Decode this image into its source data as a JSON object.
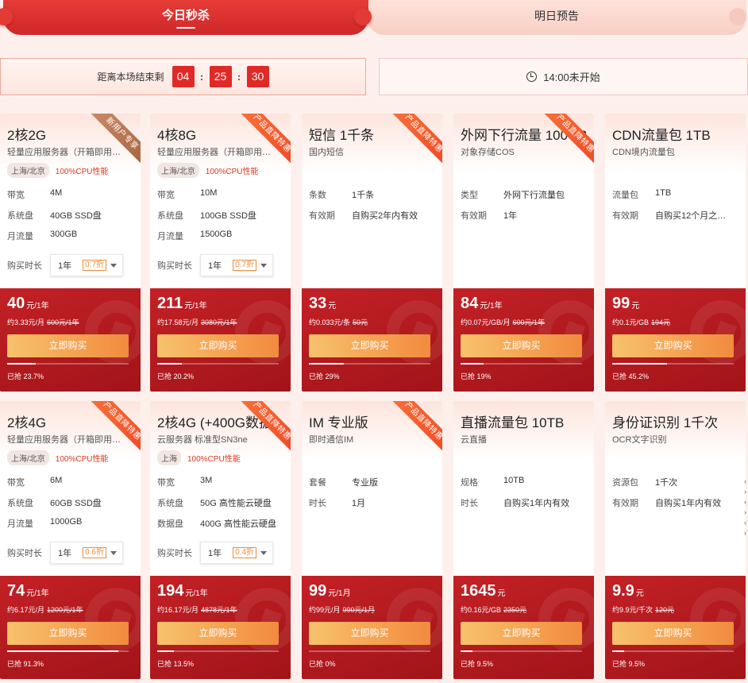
{
  "tabs": {
    "today": "今日秒杀",
    "tomorrow": "明日预告"
  },
  "countdown": {
    "label": "距离本场结束剩",
    "hours": "04",
    "minutes": "25",
    "seconds": "30"
  },
  "next_session": "14:00未开始",
  "labels": {
    "buy_duration": "购买时长",
    "buy_button": "立即购买"
  },
  "cards": [
    {
      "title": "2核2G",
      "subtitle": "轻量应用服务器（开箱即用…",
      "ribbon": "新用户专享",
      "ribbon_style": "grey",
      "location": "上海/北京",
      "cpu": "100%CPU性能",
      "specs": [
        {
          "k": "带宽",
          "v": "4M"
        },
        {
          "k": "系统盘",
          "v": "40GB SSD盘"
        },
        {
          "k": "月流量",
          "v": "300GB"
        }
      ],
      "duration": "1年",
      "discount": "0.7折",
      "price": "40",
      "unit": "元/1年",
      "per": "约3.33元/月",
      "orig": "600元/1年",
      "sold": "已抢 23.7%",
      "sold_pct": 23.7
    },
    {
      "title": "4核8G",
      "subtitle": "轻量应用服务器（开箱即用…",
      "ribbon": "产品直降特惠",
      "ribbon_style": "orange",
      "location": "上海/北京",
      "cpu": "100%CPU性能",
      "specs": [
        {
          "k": "带宽",
          "v": "10M"
        },
        {
          "k": "系统盘",
          "v": "100GB SSD盘"
        },
        {
          "k": "月流量",
          "v": "1500GB"
        }
      ],
      "duration": "1年",
      "discount": "0.7折",
      "price": "211",
      "unit": "元/1年",
      "per": "约17.58元/月",
      "orig": "3080元/1年",
      "sold": "已抢 20.2%",
      "sold_pct": 20.2
    },
    {
      "title": "短信 1千条",
      "subtitle": "国内短信",
      "ribbon": "产品直降特惠",
      "ribbon_style": "orange",
      "specs": [
        {
          "k": "条数",
          "v": "1千条"
        },
        {
          "k": "有效期",
          "v": "自购买2年内有效"
        }
      ],
      "price": "33",
      "unit": "元",
      "per": "约0.033元/条",
      "orig": "50元",
      "sold": "已抢 29%",
      "sold_pct": 29
    },
    {
      "title": "外网下行流量 100GB",
      "subtitle": "对象存储COS",
      "ribbon": "产品直降特惠",
      "ribbon_style": "orange",
      "specs": [
        {
          "k": "类型",
          "v": "外网下行流量包"
        },
        {
          "k": "有效期",
          "v": "1年"
        }
      ],
      "price": "84",
      "unit": "元/1年",
      "per": "约0.07元/GB/月",
      "orig": "600元/1年",
      "sold": "已抢 19%",
      "sold_pct": 19
    },
    {
      "title": "CDN流量包 1TB",
      "subtitle": "CDN境内流量包",
      "ribbon": "",
      "specs": [
        {
          "k": "流量包",
          "v": "1TB"
        },
        {
          "k": "有效期",
          "v": "自购买12个月之…"
        }
      ],
      "price": "99",
      "unit": "元",
      "per": "约0.1元/GB",
      "orig": "194元",
      "sold": "已抢 45.2%",
      "sold_pct": 45.2
    },
    {
      "title": "2核4G",
      "subtitle": "轻量应用服务器（开箱即用…",
      "ribbon": "产品直降特惠",
      "ribbon_style": "orange",
      "location": "上海/北京",
      "cpu": "100%CPU性能",
      "specs": [
        {
          "k": "带宽",
          "v": "6M"
        },
        {
          "k": "系统盘",
          "v": "60GB SSD盘"
        },
        {
          "k": "月流量",
          "v": "1000GB"
        }
      ],
      "duration": "1年",
      "discount": "0.6折",
      "price": "74",
      "unit": "元/1年",
      "per": "约6.17元/月",
      "orig": "1200元/1年",
      "sold": "已抢 91.3%",
      "sold_pct": 91.3
    },
    {
      "title": "2核4G (+400G数据…",
      "subtitle": "云服务器 标准型SN3ne",
      "ribbon": "产品直降特惠",
      "ribbon_style": "orange",
      "location": "上海",
      "cpu": "100%CPU性能",
      "specs": [
        {
          "k": "带宽",
          "v": "3M"
        },
        {
          "k": "系统盘",
          "v": "50G 高性能云硬盘"
        },
        {
          "k": "数据盘",
          "v": "400G 高性能云硬盘"
        }
      ],
      "duration": "1年",
      "discount": "0.4折",
      "price": "194",
      "unit": "元/1年",
      "per": "约16.17元/月",
      "orig": "4878元/1年",
      "sold": "已抢 13.5%",
      "sold_pct": 13.5
    },
    {
      "title": "IM 专业版",
      "subtitle": "即时通信IM",
      "ribbon": "产品直降特惠",
      "ribbon_style": "orange",
      "specs": [
        {
          "k": "套餐",
          "v": "专业版"
        },
        {
          "k": "时长",
          "v": "1月"
        }
      ],
      "price": "99",
      "unit": "元/1月",
      "per": "约99元/月",
      "orig": "990元/1月",
      "sold": "已抢 0%",
      "sold_pct": 0
    },
    {
      "title": "直播流量包 10TB",
      "subtitle": "云直播",
      "ribbon": "",
      "specs": [
        {
          "k": "规格",
          "v": "10TB"
        },
        {
          "k": "时长",
          "v": "自购买1年内有效"
        }
      ],
      "price": "1645",
      "unit": "元",
      "per": "约0.16元/GB",
      "orig": "2350元",
      "sold": "已抢 9.5%",
      "sold_pct": 9.5
    },
    {
      "title": "身份证识别 1千次",
      "subtitle": "OCR文字识别",
      "ribbon": "",
      "specs": [
        {
          "k": "资源包",
          "v": "1千次"
        },
        {
          "k": "有效期",
          "v": "自购买1年内有效"
        }
      ],
      "price": "9.9",
      "unit": "元",
      "per": "约9.9元/千次",
      "orig": "120元",
      "sold": "已抢 9.5%",
      "sold_pct": 9.5
    }
  ]
}
